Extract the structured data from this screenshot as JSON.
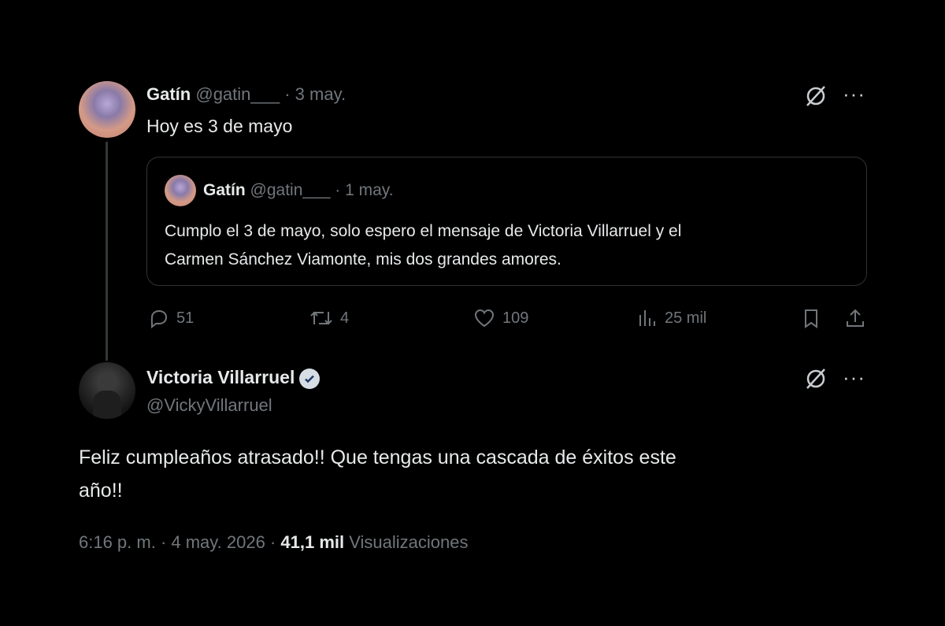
{
  "tweet1": {
    "author_name": "Gatín",
    "handle": "@gatin___",
    "date": "· 3 may.",
    "text": "Hoy es 3 de mayo",
    "quote": {
      "author_name": "Gatín",
      "handle": "@gatin___",
      "date": "· 1 may.",
      "text_line1": "Cumplo el 3 de mayo, solo espero el mensaje de Victoria Villarruel y el",
      "text_line2": "Carmen Sánchez Viamonte, mis dos  grandes amores."
    },
    "actions": {
      "replies": "51",
      "retweets": "4",
      "likes": "109",
      "views": "25 mil"
    }
  },
  "tweet2": {
    "author_name": "Victoria Villarruel",
    "handle": "@VickyVillarruel",
    "text_line1": "Feliz cumpleaños atrasado!! Que tengas una cascada de éxitos este",
    "text_line2": "año!!",
    "meta_time": "6:16 p. m. · 4 may. 2026 ·",
    "views_count": "41,1 mil",
    "views_label": "Visualizaciones"
  },
  "icons": {
    "grok": "grok-icon",
    "more": "more-icon",
    "verified": "verified-badge-icon",
    "reply": "reply-icon",
    "retweet": "retweet-icon",
    "like": "heart-icon",
    "views": "views-icon",
    "bookmark": "bookmark-icon",
    "share": "share-icon"
  },
  "colors": {
    "background": "#000000",
    "text": "#e7e9ea",
    "muted": "#71767b",
    "border": "#2f3336"
  }
}
